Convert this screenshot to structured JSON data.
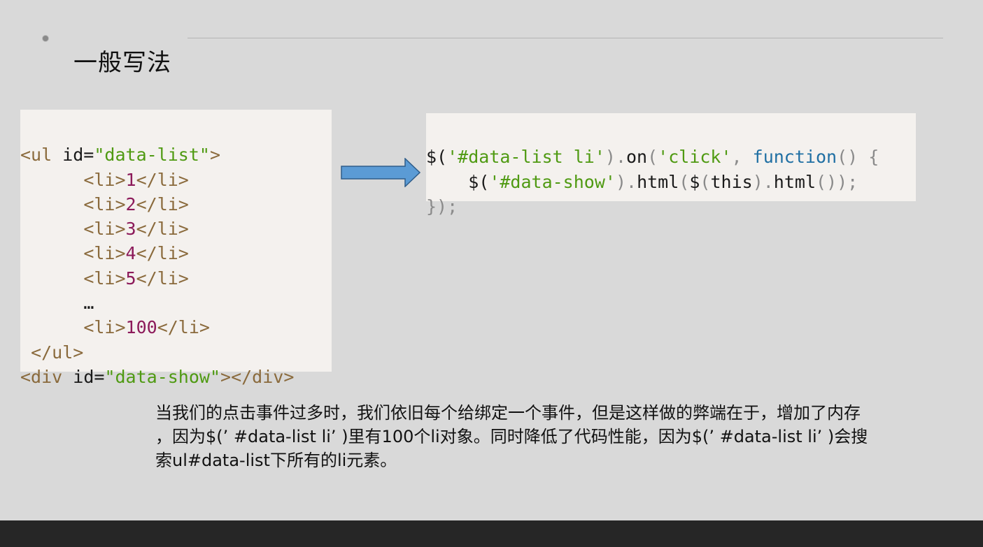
{
  "slide": {
    "title": "一般写法",
    "left_code": {
      "line1": {
        "open": "<ul",
        "attr": " id=",
        "value": "\"data-list\"",
        "close": ">"
      },
      "items": [
        {
          "open": "<li>",
          "value": "1",
          "close": "</li>"
        },
        {
          "open": "<li>",
          "value": "2",
          "close": "</li>"
        },
        {
          "open": "<li>",
          "value": "3",
          "close": "</li>"
        },
        {
          "open": "<li>",
          "value": "4",
          "close": "</li>"
        },
        {
          "open": "<li>",
          "value": "5",
          "close": "</li>"
        }
      ],
      "ellipsis": "…",
      "last_item": {
        "open": "<li>",
        "value": "100",
        "close": "</li>"
      },
      "ul_close": "</ul>",
      "div_line": {
        "open": "<div",
        "attr": " id=",
        "value": "\"data-show\"",
        "close": "></div>"
      }
    },
    "right_code": {
      "line1": {
        "p1": "$(",
        "s1": "'#data-list li'",
        "p2": ").",
        "f1": "on",
        "p3": "(",
        "s2": "'click'",
        "p4": ", ",
        "kw": "function",
        "p5": "() {"
      },
      "line2": {
        "p1": "$(",
        "s1": "'#data-show'",
        "p2": ").",
        "f1": "html",
        "p3": "(",
        "f2": "$",
        "p4": "(",
        "f3": "this",
        "p5": ").",
        "f4": "html",
        "p6": "());"
      },
      "line3": {
        "p1": "});"
      }
    },
    "description": {
      "line1": "当我们的点击事件过多时，我们依旧每个给绑定一个事件，但是这样做的弊端在于，增加了内存",
      "line2": "，因为$(’ #data-list li’ )里有100个li对象。同时降低了代码性能，因为$(’ #data-list li’ )会搜",
      "line3": "索ul#data-list下所有的li元素。"
    },
    "colors": {
      "background": "#d9d9d9",
      "code_background": "#f4f1ee",
      "arrow_fill": "#5b9bd5",
      "tag": "#8a6a3c",
      "string": "#4f9a12",
      "number": "#8c1a5a",
      "keyword": "#1f6fa3",
      "bottom_bar": "#262626"
    }
  }
}
